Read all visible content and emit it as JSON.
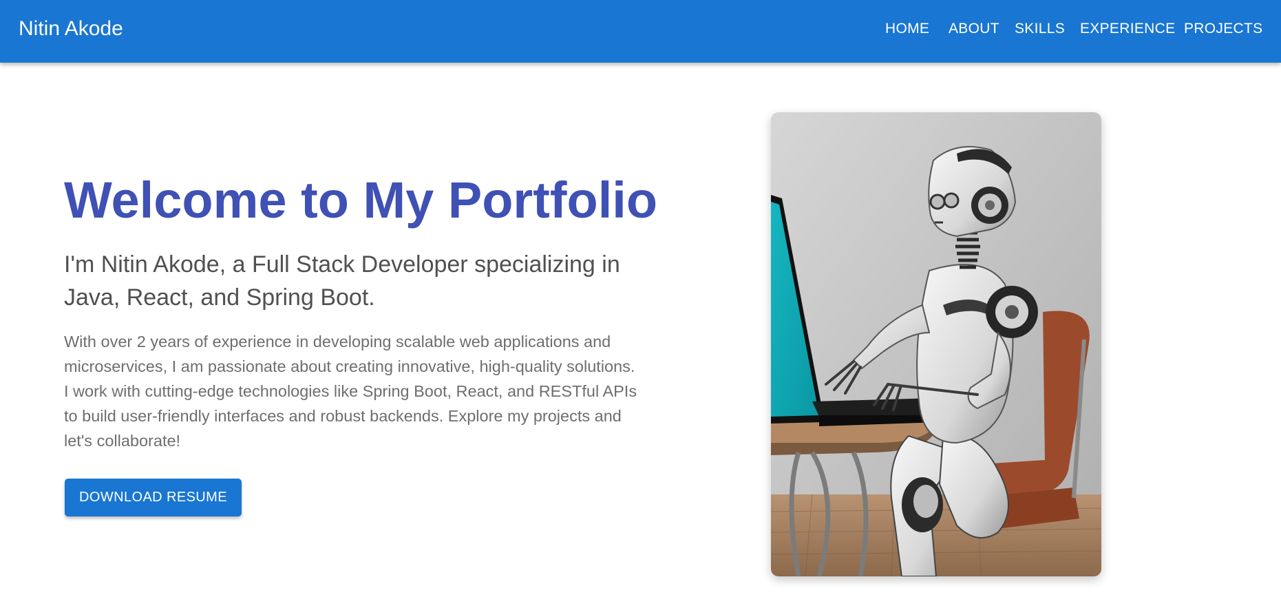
{
  "appbar": {
    "brand": "Nitin Akode",
    "nav": [
      {
        "label": "HOME"
      },
      {
        "label": "ABOUT"
      },
      {
        "label": "SKILLS"
      },
      {
        "label": "EXPERIENCE"
      },
      {
        "label": "PROJECTS"
      }
    ]
  },
  "hero": {
    "title": "Welcome to My Portfolio",
    "subtitle": "I'm Nitin Akode, a Full Stack Developer specializing in Java, React, and Spring Boot.",
    "description": "With over 2 years of experience in developing scalable web applications and microservices, I am passionate about creating innovative, high-quality solutions. I work with cutting-edge technologies like Spring Boot, React, and RESTful APIs to build user-friendly interfaces and robust backends. Explore my projects and let's collaborate!",
    "resume_button": "DOWNLOAD RESUME",
    "image_subject": "robot-at-laptop-illustration"
  },
  "colors": {
    "appbar": "#1976d2",
    "title": "#3f51b5",
    "subtitle": "#505050",
    "body_text": "#6e6e6e",
    "button": "#1976d2"
  }
}
